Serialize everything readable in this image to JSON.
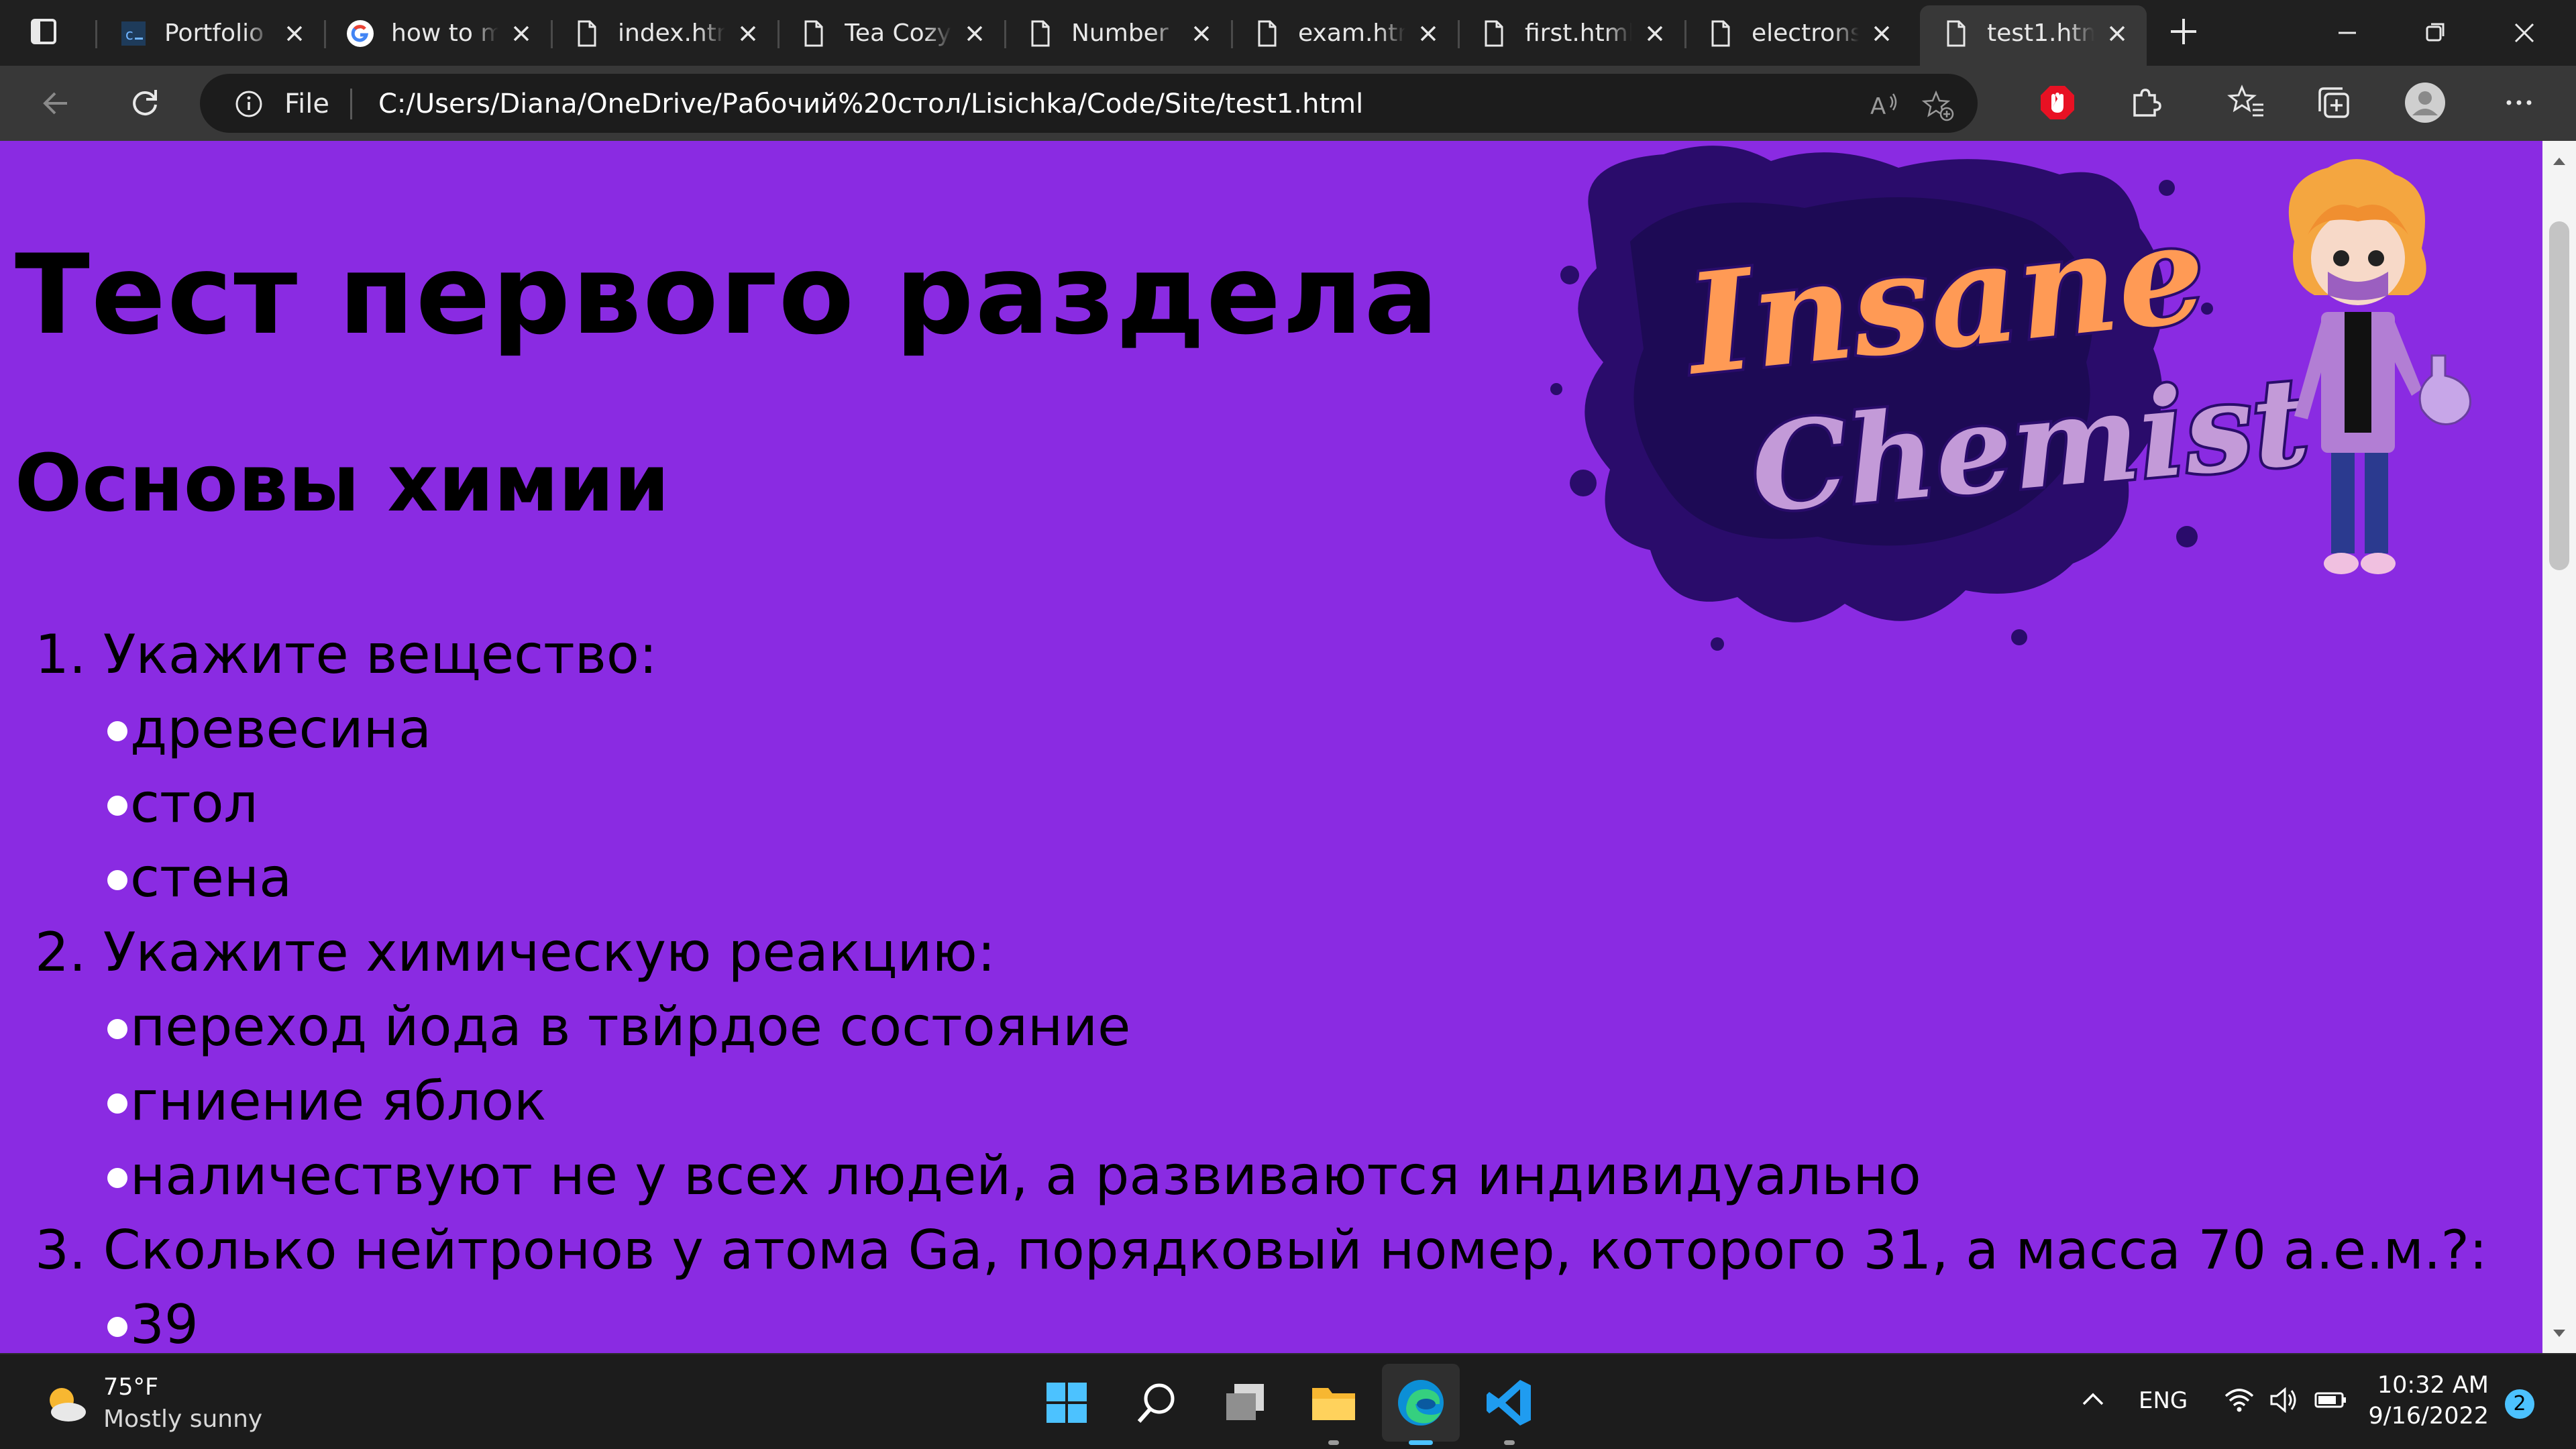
{
  "browser": {
    "tabs": [
      {
        "title": "Portfolio",
        "icon": "codepen-style-page-icon"
      },
      {
        "title": "how to m",
        "icon": "google-icon"
      },
      {
        "title": "index.htm",
        "icon": "page-icon"
      },
      {
        "title": "Tea Cozy",
        "icon": "page-icon"
      },
      {
        "title": "Number",
        "icon": "page-icon"
      },
      {
        "title": "exam.htm",
        "icon": "page-icon"
      },
      {
        "title": "first.html",
        "icon": "page-icon"
      },
      {
        "title": "electrons",
        "icon": "page-icon"
      },
      {
        "title": "test1.htm",
        "icon": "page-icon",
        "active": true
      }
    ],
    "address": {
      "scheme_label": "File",
      "url": "C:/Users/Diana/OneDrive/Рабочий%20стол/Lisichka/Code/Site/test1.html"
    },
    "colors": {
      "chrome": "#202020",
      "toolbar": "#383838",
      "adblock": "#e81123"
    }
  },
  "page": {
    "background": "#8a2be2",
    "title": "Тест первого раздела",
    "subtitle": "Основы химии",
    "logo_text": [
      "Insane",
      "Chemist"
    ],
    "questions": [
      {
        "text": "1. Укажите вещество:",
        "options": [
          "древесина",
          "стол",
          "стена"
        ]
      },
      {
        "text": "2. Укажите химическую реакцию:",
        "options": [
          "переход йода в твйрдое состояние",
          "гниение яблок",
          "наличествуют не у всех людей, а развиваются индивидуально"
        ]
      },
      {
        "text": "3. Сколько нейтронов у атома Ga, порядковый номер, которого 31, а масса 70 а.е.м.?:",
        "options": [
          "39"
        ]
      }
    ]
  },
  "taskbar": {
    "weather": {
      "temp": "75°F",
      "condition": "Mostly sunny"
    },
    "apps": [
      "start-icon",
      "search-icon",
      "task-view-icon",
      "file-explorer-icon",
      "edge-icon",
      "vscode-icon"
    ],
    "language": "ENG",
    "time": "10:32 AM",
    "date": "9/16/2022",
    "notifications": "2"
  }
}
